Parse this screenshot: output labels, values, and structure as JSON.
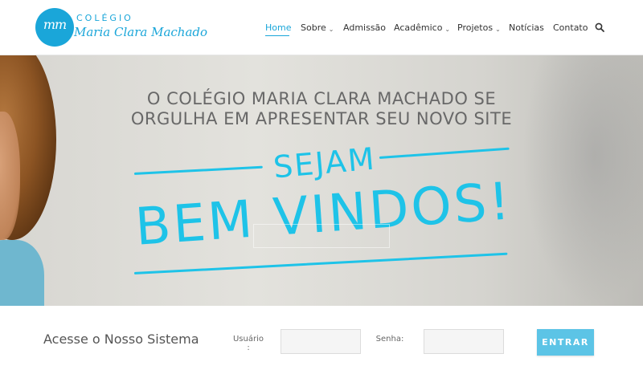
{
  "logo": {
    "monogram": "mm",
    "top_text": "COLÉGIO",
    "name_text": "Maria Clara Machado"
  },
  "nav": {
    "items": [
      {
        "label": "Home",
        "active": true
      },
      {
        "label": "Sobre",
        "dropdown": true
      },
      {
        "label": "Admissão"
      },
      {
        "label": "Acadêmico",
        "dropdown": true
      },
      {
        "label": "Projetos",
        "dropdown": true
      },
      {
        "label": "Notícias"
      },
      {
        "label": "Contato"
      }
    ],
    "caret": "⌄",
    "search_icon": "search-icon"
  },
  "hero": {
    "line1": "O COLÉGIO MARIA CLARA MACHADO SE",
    "line2": "ORGULHA EM APRESENTAR SEU NOVO SITE",
    "sejam": "SEJAM",
    "bem_vindos": "BEM VINDOS!"
  },
  "login": {
    "title": "Acesse o Nosso Sistema",
    "user_label": "Usuário :",
    "password_label": "Senha:",
    "user_value": "",
    "password_value": "",
    "button_label": "ENTRAR"
  },
  "colors": {
    "brand": "#1aa6d9",
    "accent": "#1ec3e8",
    "button": "#5cc4e6",
    "hero_text": "#686868"
  }
}
